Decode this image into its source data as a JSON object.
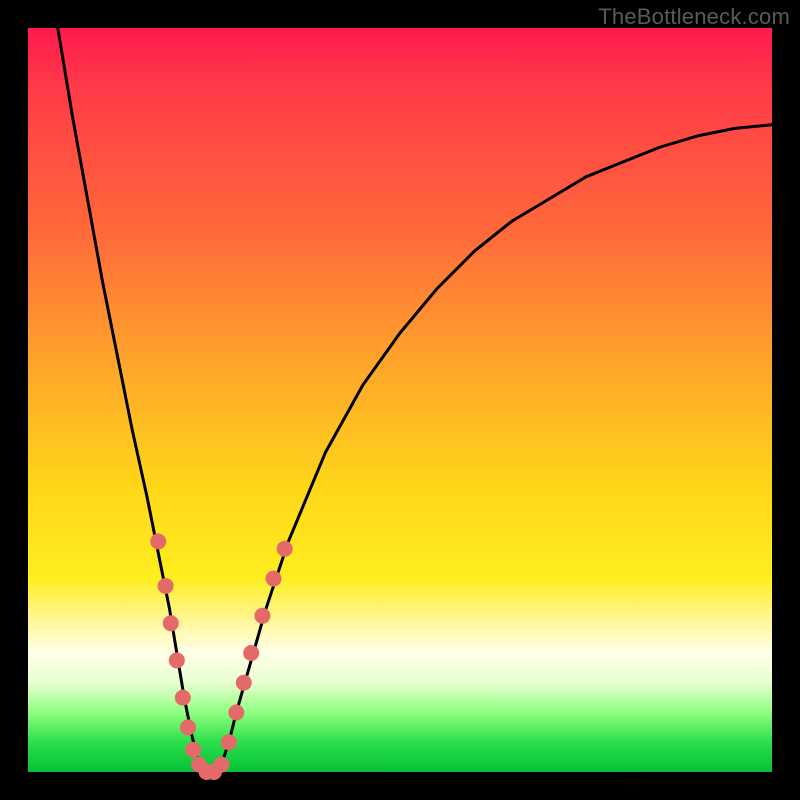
{
  "watermark": "TheBottleneck.com",
  "colors": {
    "curve": "#000000",
    "marker": "#e46a6a",
    "background_frame": "#000000"
  },
  "chart_data": {
    "type": "line",
    "title": "",
    "xlabel": "",
    "ylabel": "",
    "xlim": [
      0,
      100
    ],
    "ylim": [
      0,
      100
    ],
    "series": [
      {
        "name": "bottleneck-curve",
        "x": [
          4,
          6,
          8,
          10,
          12,
          14,
          16,
          18,
          19,
          20,
          21,
          22,
          23,
          24,
          25,
          26,
          27,
          28,
          30,
          32,
          35,
          40,
          45,
          50,
          55,
          60,
          65,
          70,
          75,
          80,
          85,
          90,
          95,
          100
        ],
        "y": [
          100,
          88,
          77,
          66,
          56,
          46,
          37,
          27,
          22,
          16,
          10,
          5,
          1,
          0,
          0,
          1,
          4,
          8,
          15,
          22,
          31,
          43,
          52,
          59,
          65,
          70,
          74,
          77,
          80,
          82,
          84,
          85.5,
          86.5,
          87
        ]
      }
    ],
    "markers": {
      "name": "highlighted-points",
      "points": [
        {
          "x": 17.5,
          "y": 31
        },
        {
          "x": 18.5,
          "y": 25
        },
        {
          "x": 19.2,
          "y": 20
        },
        {
          "x": 20.0,
          "y": 15
        },
        {
          "x": 20.8,
          "y": 10
        },
        {
          "x": 21.5,
          "y": 6
        },
        {
          "x": 22.2,
          "y": 3
        },
        {
          "x": 23.0,
          "y": 1
        },
        {
          "x": 24.0,
          "y": 0
        },
        {
          "x": 25.0,
          "y": 0
        },
        {
          "x": 26.0,
          "y": 1
        },
        {
          "x": 27.0,
          "y": 4
        },
        {
          "x": 28.0,
          "y": 8
        },
        {
          "x": 29.0,
          "y": 12
        },
        {
          "x": 30.0,
          "y": 16
        },
        {
          "x": 31.5,
          "y": 21
        },
        {
          "x": 33.0,
          "y": 26
        },
        {
          "x": 34.5,
          "y": 30
        }
      ]
    }
  }
}
